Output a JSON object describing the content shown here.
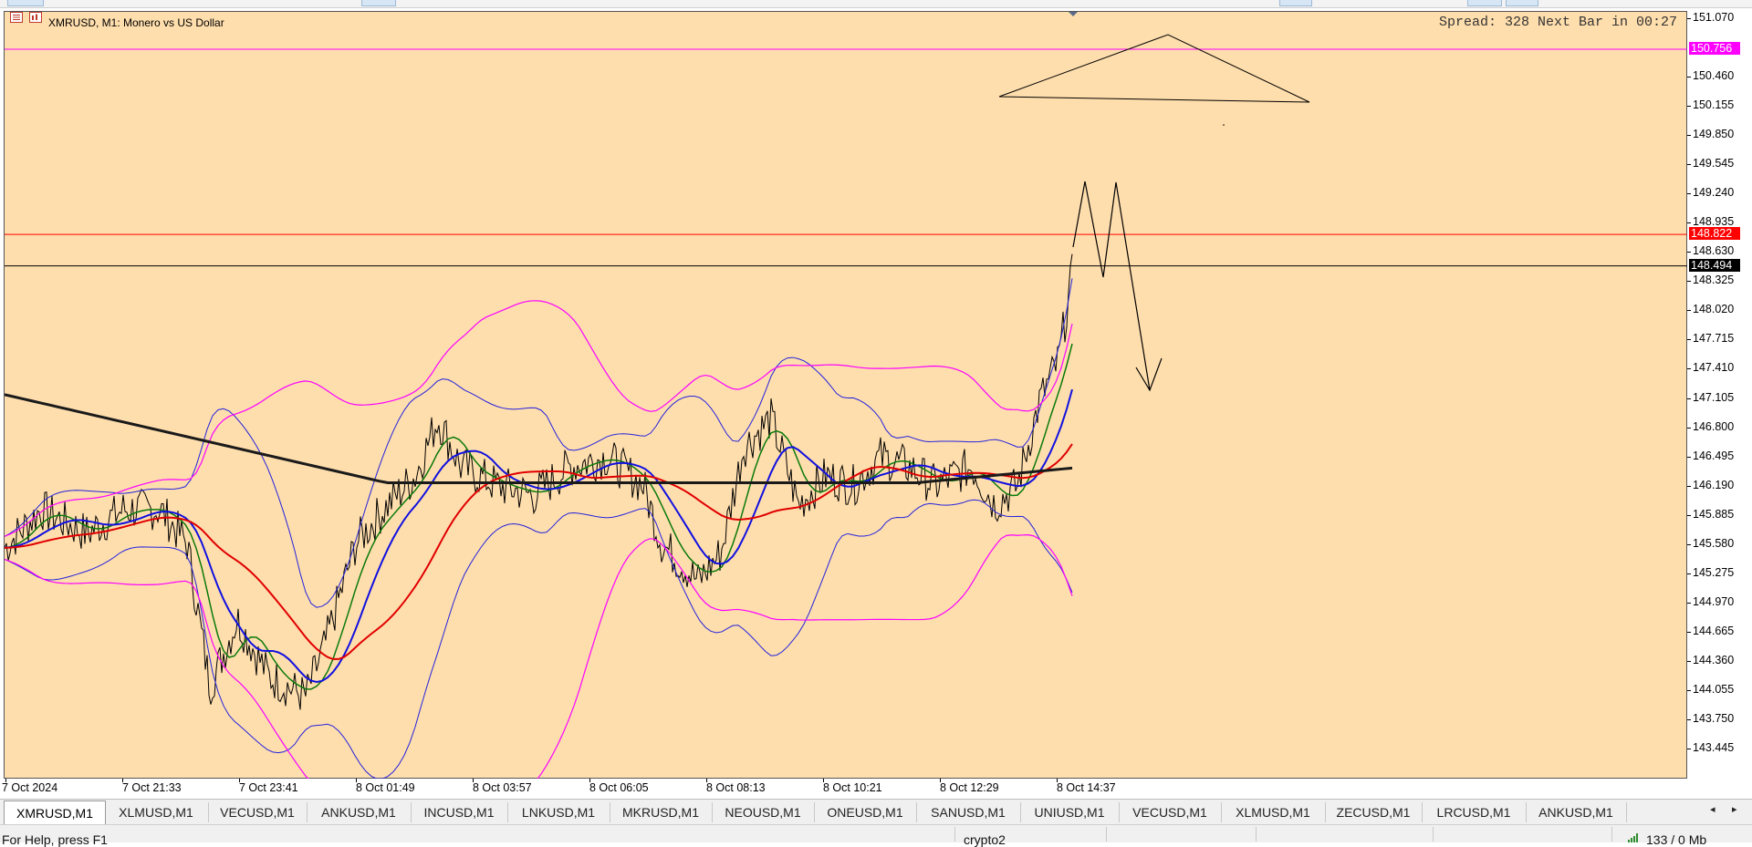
{
  "chart": {
    "title": "XMRUSD, M1:  Monero vs US Dollar",
    "spread_text": "Spread: 328 Next Bar in 00:27",
    "colors": {
      "background": "#ffdead",
      "sell_line": "#ff00ff",
      "resistance_line": "#ff0000",
      "bid_line": "#000000",
      "ma_slow": "#1a1a1a",
      "ma_red": "#e00000",
      "ma_blue": "#1010e0",
      "ma_green": "#0a7a0a",
      "bands": "#ff00ff",
      "bands_inner": "#2222dd"
    }
  },
  "price_axis": {
    "labels": [
      "151.070",
      "150.460",
      "150.155",
      "149.850",
      "149.545",
      "149.240",
      "148.935",
      "148.630",
      "148.325",
      "148.020",
      "147.715",
      "147.410",
      "147.105",
      "146.800",
      "146.495",
      "146.190",
      "145.885",
      "145.580",
      "145.275",
      "144.970",
      "144.665",
      "144.360",
      "144.055",
      "143.750",
      "143.445"
    ],
    "badges": [
      {
        "label": "150.756",
        "price": 150.756,
        "color": "#ff00ff"
      },
      {
        "label": "148.822",
        "price": 148.822,
        "color": "#ff0000"
      },
      {
        "label": "148.494",
        "price": 148.494,
        "color": "#000000"
      }
    ]
  },
  "time_axis": {
    "labels": [
      "7 Oct 2024",
      "7 Oct 21:33",
      "7 Oct 23:41",
      "8 Oct 01:49",
      "8 Oct 03:57",
      "8 Oct 06:05",
      "8 Oct 08:13",
      "8 Oct 10:21",
      "8 Oct 12:29",
      "8 Oct 14:37"
    ]
  },
  "tabs": [
    {
      "label": "XMRUSD,M1",
      "active": true
    },
    {
      "label": "XLMUSD,M1"
    },
    {
      "label": "VECUSD,M1"
    },
    {
      "label": "ANKUSD,M1"
    },
    {
      "label": "INCUSD,M1"
    },
    {
      "label": "LNKUSD,M1"
    },
    {
      "label": "MKRUSD,M1"
    },
    {
      "label": "NEOUSD,M1"
    },
    {
      "label": "ONEUSD,M1"
    },
    {
      "label": "SANUSD,M1"
    },
    {
      "label": "UNIUSD,M1"
    },
    {
      "label": "VECUSD,M1"
    },
    {
      "label": "XLMUSD,M1"
    },
    {
      "label": "ZECUSD,M1"
    },
    {
      "label": "LRCUSD,M1"
    },
    {
      "label": "ANKUSD,M1"
    }
  ],
  "tab_scroll": {
    "left": "◂",
    "right": "▸"
  },
  "status": {
    "help": "For Help, press F1",
    "profile": "crypto2",
    "traffic": "133 / 0 Mb"
  }
}
